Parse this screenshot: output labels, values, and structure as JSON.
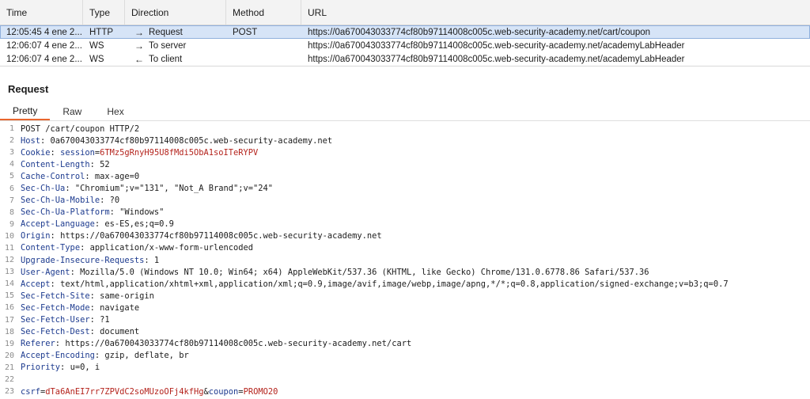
{
  "history": {
    "columns": [
      "Time",
      "Type",
      "Direction",
      "Method",
      "URL"
    ],
    "rows": [
      {
        "time": "12:05:45 4 ene 2...",
        "type": "HTTP",
        "arrow": "→",
        "direction": "Request",
        "method": "POST",
        "url": "https://0a670043033774cf80b97114008c005c.web-security-academy.net/cart/coupon",
        "selected": true
      },
      {
        "time": "12:06:07 4 ene 2...",
        "type": "WS",
        "arrow": "→",
        "direction": "To server",
        "method": "",
        "url": "https://0a670043033774cf80b97114008c005c.web-security-academy.net/academyLabHeader",
        "selected": false
      },
      {
        "time": "12:06:07 4 ene 2...",
        "type": "WS",
        "arrow": "←",
        "direction": "To client",
        "method": "",
        "url": "https://0a670043033774cf80b97114008c005c.web-security-academy.net/academyLabHeader",
        "selected": false
      }
    ]
  },
  "pane": {
    "title": "Request",
    "tabs": [
      "Pretty",
      "Raw",
      "Hex"
    ],
    "active_tab": "Pretty"
  },
  "request": {
    "request_line": "POST /cart/coupon HTTP/2",
    "headers": [
      {
        "name": "Host",
        "value": "0a670043033774cf80b97114008c005c.web-security-academy.net"
      },
      {
        "name": "Cookie",
        "value": "",
        "cookie_name": "session",
        "cookie_value": "6TMz5gRnyH95U8fMdi5ObA1soITeRYPV"
      },
      {
        "name": "Content-Length",
        "value": "52"
      },
      {
        "name": "Cache-Control",
        "value": "max-age=0"
      },
      {
        "name": "Sec-Ch-Ua",
        "value": "\"Chromium\";v=\"131\", \"Not_A Brand\";v=\"24\""
      },
      {
        "name": "Sec-Ch-Ua-Mobile",
        "value": "?0"
      },
      {
        "name": "Sec-Ch-Ua-Platform",
        "value": "\"Windows\""
      },
      {
        "name": "Accept-Language",
        "value": "es-ES,es;q=0.9"
      },
      {
        "name": "Origin",
        "value": "https://0a670043033774cf80b97114008c005c.web-security-academy.net"
      },
      {
        "name": "Content-Type",
        "value": "application/x-www-form-urlencoded"
      },
      {
        "name": "Upgrade-Insecure-Requests",
        "value": "1"
      },
      {
        "name": "User-Agent",
        "value": "Mozilla/5.0 (Windows NT 10.0; Win64; x64) AppleWebKit/537.36 (KHTML, like Gecko) Chrome/131.0.6778.86 Safari/537.36"
      },
      {
        "name": "Accept",
        "value": "text/html,application/xhtml+xml,application/xml;q=0.9,image/avif,image/webp,image/apng,*/*;q=0.8,application/signed-exchange;v=b3;q=0.7"
      },
      {
        "name": "Sec-Fetch-Site",
        "value": "same-origin"
      },
      {
        "name": "Sec-Fetch-Mode",
        "value": "navigate"
      },
      {
        "name": "Sec-Fetch-User",
        "value": "?1"
      },
      {
        "name": "Sec-Fetch-Dest",
        "value": "document"
      },
      {
        "name": "Referer",
        "value": "https://0a670043033774cf80b97114008c005c.web-security-academy.net/cart"
      },
      {
        "name": "Accept-Encoding",
        "value": "gzip, deflate, br"
      },
      {
        "name": "Priority",
        "value": "u=0, i"
      }
    ],
    "body_params": [
      {
        "name": "csrf",
        "value": "dTa6AnEI7rr7ZPVdC2soMUzoOFj4kfHg"
      },
      {
        "name": "coupon",
        "value": "PROMO20"
      }
    ]
  },
  "colors": {
    "selected_row": "#d6e4f7",
    "header_name": "#1d3b8f",
    "param_value": "#b4231c",
    "active_tab_underline": "#e8662d"
  }
}
